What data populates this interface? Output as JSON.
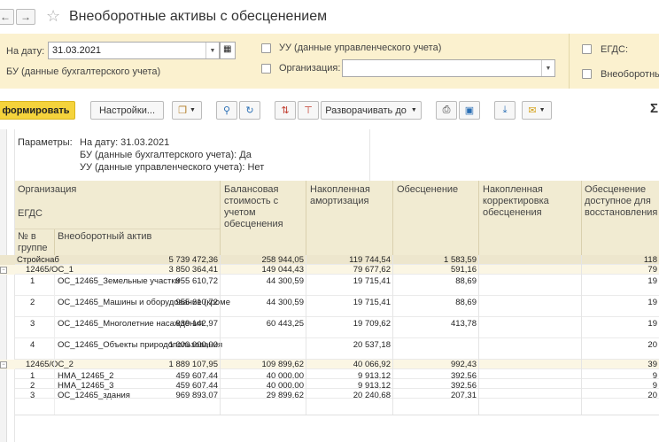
{
  "window": {
    "title": "Внеоборотные активы с обесценением"
  },
  "params": {
    "date_label": "На дату:",
    "date_value": "31.03.2021",
    "bu_label": "БУ (данные бухгалтерского учета)",
    "uu_label": "УУ (данные управленческого учета)",
    "org_label": "Организация:",
    "org_value": "",
    "egds_label": "ЕГДС:",
    "vneob_label": "Внеоборотны"
  },
  "toolbar": {
    "generate_label": "формировать",
    "settings_label": "Настройки...",
    "expand_label": "Разворачивать до",
    "sigma": "Σ"
  },
  "report": {
    "params_title": "Параметры:",
    "param_lines": [
      "На дату: 31.03.2021",
      "БУ (данные бухгалтерского учета): Да",
      "УУ (данные управленческого учета): Нет"
    ],
    "headers": {
      "org": "Организация",
      "egds": "ЕГДС",
      "num": "№ в группе",
      "asset": "Внеоборотный актив",
      "balance": "Балансовая стоимость с учетом обесценения",
      "amort": "Накопленная амортизация",
      "impair": "Обесценение",
      "corr": "Накопленная корректировка обесценения",
      "restore": "Обесценение доступное для восстановления"
    },
    "rows": [
      {
        "type": "total",
        "label": "Стройснаб",
        "balance": "5 739 472,36",
        "amort": "258 944,05",
        "impair": "119 744,54",
        "corr": "1 583,59",
        "restore": "118"
      },
      {
        "type": "group",
        "label": "12465/ОС_1",
        "balance": "3 850 364,41",
        "amort": "149 044,43",
        "impair": "79 677,62",
        "corr": "591,16",
        "restore": "79"
      },
      {
        "type": "item",
        "num": "1",
        "label": "ОС_12465_Земельные участки",
        "balance": "955 610,72",
        "amort": "44 300,59",
        "impair": "19 715,41",
        "corr": "88,69",
        "restore": "19"
      },
      {
        "type": "item",
        "num": "2",
        "label": "ОС_12465_Машины и оборудование (кроме",
        "balance": "955 610,72",
        "amort": "44 300,59",
        "impair": "19 715,41",
        "corr": "88,69",
        "restore": "19"
      },
      {
        "type": "item",
        "num": "3",
        "label": "ОС_12465_Многолетние насаждения",
        "balance": "939 142,97",
        "amort": "60 443,25",
        "impair": "19 709,62",
        "corr": "413,78",
        "restore": "19"
      },
      {
        "type": "item",
        "num": "4",
        "label": "ОС_12465_Объекты природопользования",
        "balance": "1 000 000,00",
        "amort": "",
        "impair": "20 537,18",
        "corr": "",
        "restore": "20"
      },
      {
        "type": "group",
        "label": "12465/ОС_2",
        "balance": "1 889 107,95",
        "amort": "109 899,62",
        "impair": "40 066,92",
        "corr": "992,43",
        "restore": "39"
      },
      {
        "type": "item",
        "num": "1",
        "label": "НМА_12465_2",
        "balance": "459 607,44",
        "amort": "40 000,00",
        "impair": "9 913,12",
        "corr": "392,56",
        "restore": "9"
      },
      {
        "type": "item",
        "num": "2",
        "label": "НМА_12465_3",
        "balance": "459 607,44",
        "amort": "40 000,00",
        "impair": "9 913,12",
        "corr": "392,56",
        "restore": "9"
      },
      {
        "type": "item",
        "num": "3",
        "label": "ОС_12465_здания",
        "balance": "969 893,07",
        "amort": "29 899,62",
        "impair": "20 240,68",
        "corr": "207,31",
        "restore": "20"
      }
    ]
  }
}
